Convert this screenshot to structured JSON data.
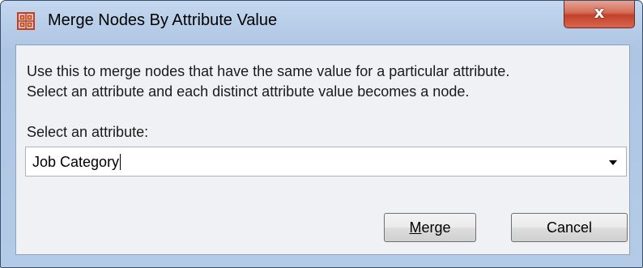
{
  "window": {
    "title": "Merge Nodes By Attribute Value",
    "close_label": "x"
  },
  "icons": {
    "app": "network-nodes-icon",
    "close": "close-icon",
    "dropdown": "chevron-down-icon"
  },
  "colors": {
    "app_icon": "#d33a12",
    "close_button": "#c2422b",
    "titlebar": "#b7cde8"
  },
  "dialog": {
    "description_line1": "Use this to merge nodes that have the same value for a particular attribute.",
    "description_line2": "Select an attribute and each distinct attribute value becomes a node.",
    "select_label": "Select an attribute:",
    "selected_attribute": "Job Category"
  },
  "buttons": {
    "merge_mnemonic": "M",
    "merge_rest": "erge",
    "cancel": "Cancel"
  }
}
